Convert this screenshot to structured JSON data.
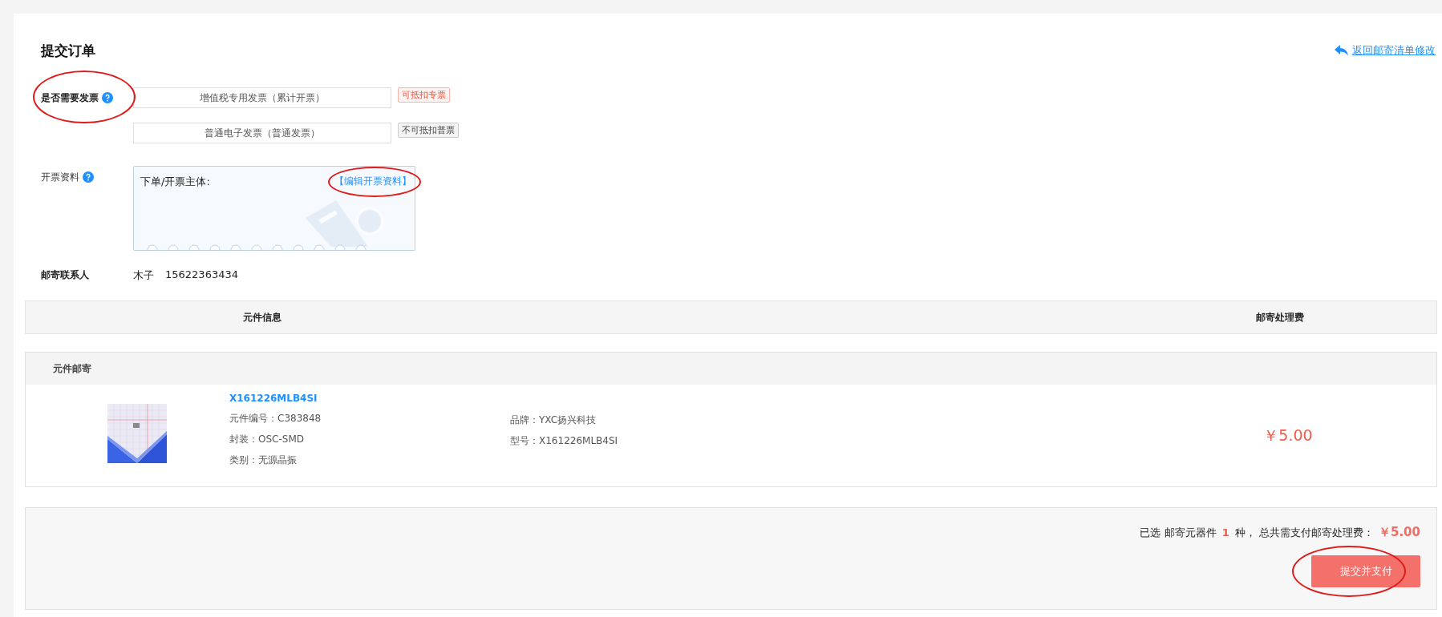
{
  "page_title": "提交订单",
  "back_link": {
    "label": "返回邮寄清单修改"
  },
  "invoice": {
    "label": "是否需要发票",
    "circled": true,
    "options": [
      {
        "label": "增值税专用发票（累计开票）",
        "tag": "可抵扣专票",
        "kind": "special"
      },
      {
        "label": "普通电子发票（普通发票）",
        "tag": "不可抵扣普票",
        "kind": "normal"
      }
    ]
  },
  "invoice_info": {
    "label": "开票资料",
    "subject_label": "下单/开票主体:",
    "edit_link": "【编辑开票资料】",
    "edit_circled": true
  },
  "contact": {
    "label": "邮寄联系人",
    "name": "木子",
    "phone": "15622363434"
  },
  "table": {
    "columns": [
      "元件信息",
      "邮寄处理费"
    ],
    "group": {
      "title": "元件邮寄",
      "rows": [
        {
          "name": "X161226MLB4SI",
          "part_no": "元件编号：C383848",
          "package": "封装：OSC-SMD",
          "category": "类别：无源晶振",
          "brand": "品牌：YXC扬兴科技",
          "model": "型号：X161226MLB4SI",
          "fee": "￥5.00"
        }
      ]
    }
  },
  "summary": {
    "text": "已选 邮寄元器件 **1** 种， 总共需支付邮寄处理费：",
    "total": "￥5.00"
  },
  "submit_button": {
    "label": "提交并支付",
    "circled": true
  }
}
